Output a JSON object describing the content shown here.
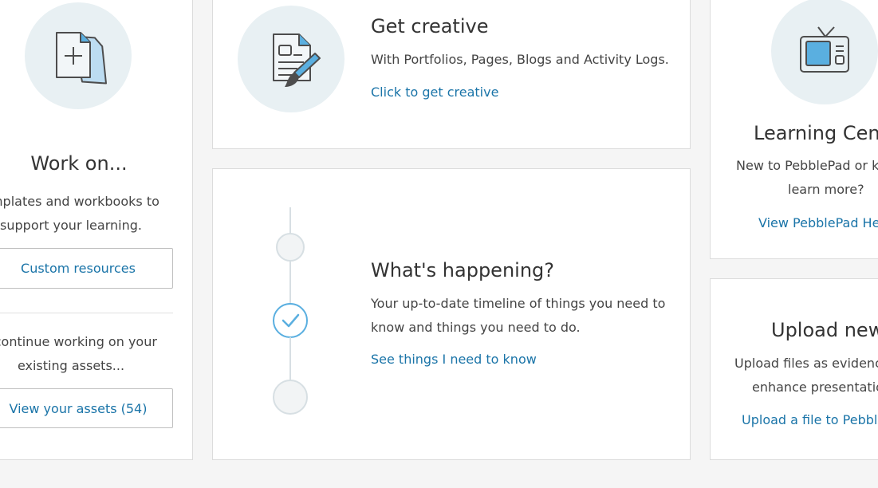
{
  "left_card": {
    "title": "Work on...",
    "text_a_line1": "emplates and workbooks to",
    "text_a_line2": "support your learning.",
    "custom_button": "Custom resources",
    "text_b_line1": "r continue working on your",
    "text_b_line2": "existing assets...",
    "assets_button": "View your assets (54)"
  },
  "creative_card": {
    "title": "Get creative",
    "text": "With Portfolios, Pages, Blogs and Activity Logs.",
    "link": "Click to get creative"
  },
  "happening_card": {
    "title": "What's happening?",
    "text_line1": "Your up-to-date timeline of things you need to",
    "text_line2": "know and things you need to do.",
    "link": "See things I need to know"
  },
  "learning_card": {
    "title": "Learning Cent",
    "text_line1": "New to PebblePad or ke",
    "text_line2": "learn more?",
    "link": "View PebblePad He"
  },
  "upload_card": {
    "title": "Upload new",
    "text_line1": "Upload files as evidence",
    "text_line2": "enhance presentatio",
    "link": "Upload a file to Pebble"
  },
  "colors": {
    "accent": "#1a74a8",
    "icon_circle": "#e8f0f3",
    "icon_fill": "#5aafe0",
    "timeline": "#d7dfe3",
    "check": "#5aafe0"
  }
}
